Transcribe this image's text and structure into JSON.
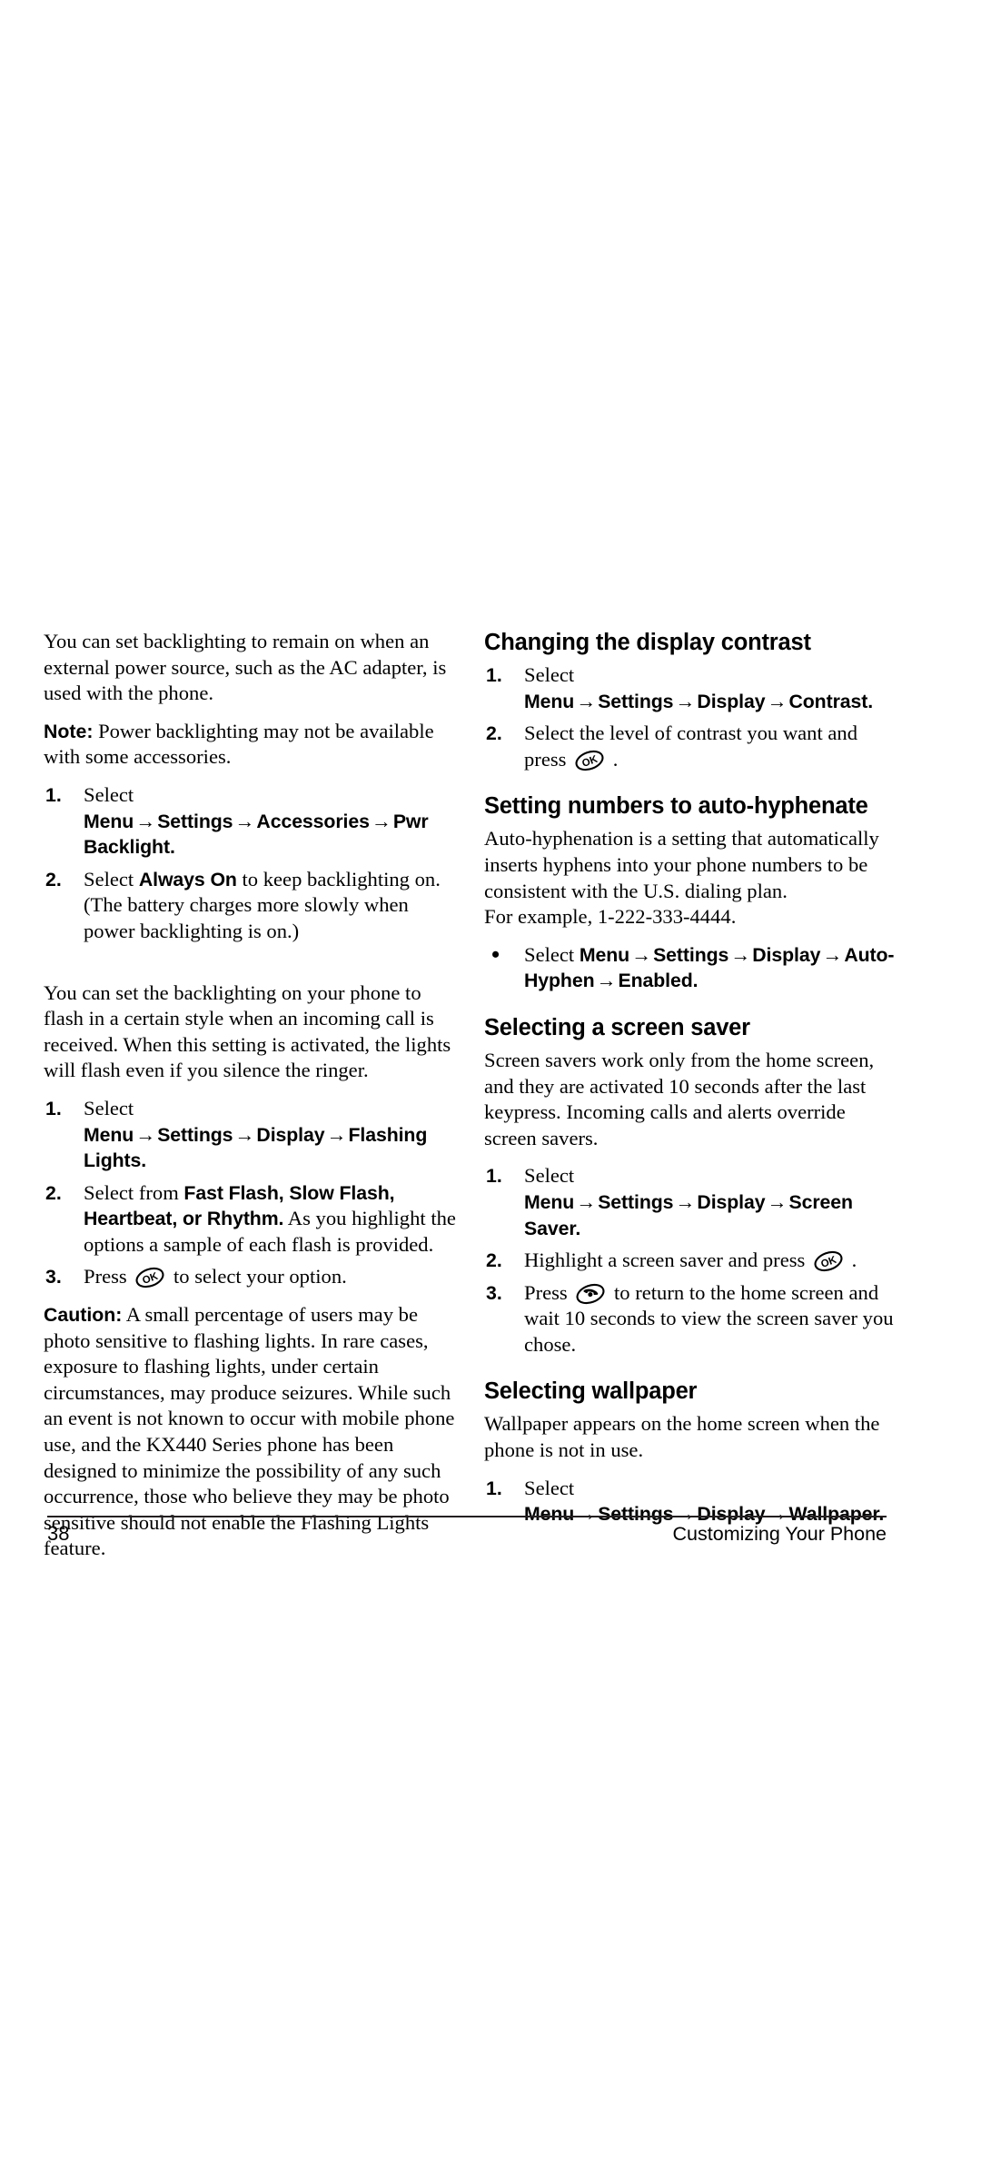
{
  "page": {
    "number": "38",
    "running_head": "Customizing Your Phone"
  },
  "icons": {
    "ok_key": "ok-key-icon",
    "end_key": "end-call-key-icon",
    "arrow": "→",
    "bullet": "•"
  },
  "left_column": {
    "backlight_intro": "You can set backlighting to remain on when an external power source, such as the AC adapter, is used with the phone.",
    "note_label": "Note:",
    "note_text": " Power backlighting may not be available with some accessories.",
    "pwr_steps": [
      {
        "marker": "1.",
        "pre": "Select ",
        "path": [
          "Menu",
          "Settings",
          "Accessories",
          "Pwr Backlight."
        ]
      },
      {
        "marker": "2.",
        "pre": "Select ",
        "bold": "Always On",
        "post": " to keep backlighting on. (The battery charges more slowly when power backlighting is on.)"
      }
    ],
    "flash_intro": "You can set the backlighting on your phone to flash in a certain style when an incoming call is received. When this setting is activated, the lights will flash even if you silence the ringer.",
    "flash_steps": [
      {
        "marker": "1.",
        "pre": "Select ",
        "path": [
          "Menu",
          "Settings",
          "Display",
          "Flashing Lights."
        ]
      },
      {
        "marker": "2.",
        "pre": "Select from ",
        "bold": "Fast Flash, Slow Flash, Heartbeat, or Rhythm.",
        "post": " As you highlight the options a sample of each flash is provided."
      },
      {
        "marker": "3.",
        "pre": "Press ",
        "icon": "ok-key-icon",
        "post": " to select your option."
      }
    ],
    "caution_label": "Caution:",
    "caution_text": " A small percentage of users may be photo sensitive to flashing lights. In rare cases, exposure to flashing lights, under certain circumstances, may produce seizures. While such an event is not known to occur with mobile phone use, and the KX440 Series phone has been designed to minimize the possibility of any such occurrence, those who believe they may be photo sensitive should not enable the Flashing Lights feature."
  },
  "right_column": {
    "contrast": {
      "heading": "Changing the display contrast",
      "steps": [
        {
          "marker": "1.",
          "pre": "Select ",
          "path": [
            "Menu",
            "Settings",
            "Display",
            "Contrast."
          ]
        },
        {
          "marker": "2.",
          "pre": "Select the level of contrast you want and press ",
          "icon": "ok-key-icon",
          "post": " ."
        }
      ]
    },
    "hyphenate": {
      "heading": "Setting numbers to auto-hyphenate",
      "intro": "Auto-hyphenation is a setting that automatically inserts hyphens into your phone numbers to be consistent with the U.S. dialing plan.",
      "example": "For example, 1-222-333-4444.",
      "steps": [
        {
          "marker": "•",
          "pre": "Select ",
          "path": [
            "Menu",
            "Settings",
            "Display",
            "Auto-Hyphen",
            "Enabled."
          ]
        }
      ]
    },
    "screensaver": {
      "heading": "Selecting a screen saver",
      "intro": "Screen savers work only from the home screen, and they are activated 10 seconds after the last keypress. Incoming calls and alerts override screen savers.",
      "steps": [
        {
          "marker": "1.",
          "pre": "Select ",
          "path": [
            "Menu",
            "Settings",
            "Display",
            "Screen Saver."
          ]
        },
        {
          "marker": "2.",
          "pre": "Highlight a screen saver and press ",
          "icon": "ok-key-icon",
          "post": " ."
        },
        {
          "marker": "3.",
          "pre": "Press ",
          "icon": "end-call-key-icon",
          "post": " to return to the home screen and wait 10 seconds to view the screen saver you chose."
        }
      ]
    },
    "wallpaper": {
      "heading": "Selecting wallpaper",
      "intro": "Wallpaper appears on the home screen when the phone is not in use.",
      "steps": [
        {
          "marker": "1.",
          "pre": "Select ",
          "path": [
            "Menu",
            "Settings",
            "Display",
            "Wallpaper."
          ]
        }
      ]
    }
  }
}
